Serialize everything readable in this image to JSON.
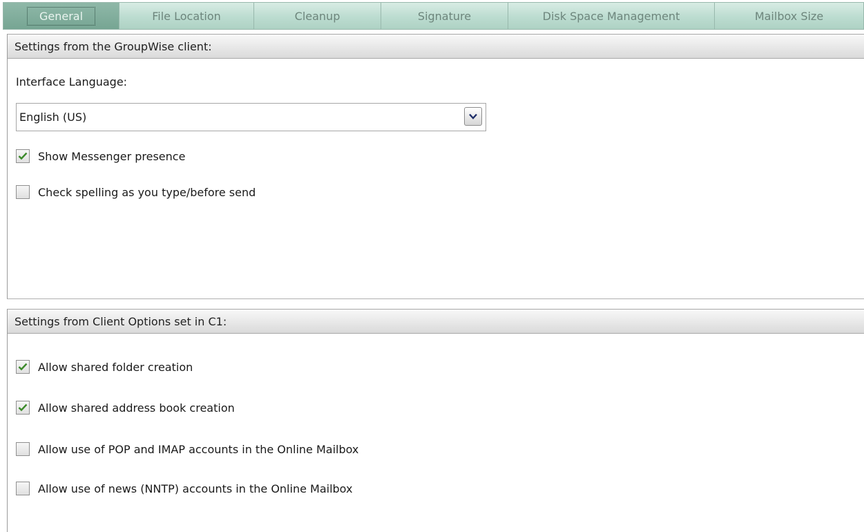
{
  "tabs": [
    {
      "label": "General",
      "active": true
    },
    {
      "label": "File Location"
    },
    {
      "label": "Cleanup"
    },
    {
      "label": "Signature"
    },
    {
      "label": "Disk Space Management"
    },
    {
      "label": "Mailbox Size"
    }
  ],
  "groupwise_section": {
    "header": "Settings from the GroupWise client:",
    "language_label": "Interface Language:",
    "language_value": "English (US)",
    "options": [
      {
        "label": "Show Messenger presence",
        "checked": true
      },
      {
        "label": "Check spelling as you type/before send",
        "checked": false
      }
    ]
  },
  "client_options_section": {
    "header": "Settings from Client Options set in C1:",
    "options": [
      {
        "label": "Allow shared folder creation",
        "checked": true
      },
      {
        "label": "Allow shared address book creation",
        "checked": true
      },
      {
        "label": "Allow use of POP and IMAP accounts in the Online Mailbox",
        "checked": false
      },
      {
        "label": "Allow use of news (NNTP) accounts in the Online Mailbox",
        "checked": false
      }
    ]
  },
  "colors": {
    "check": "#3b8a2a",
    "active_tab": "#7fab9a"
  }
}
